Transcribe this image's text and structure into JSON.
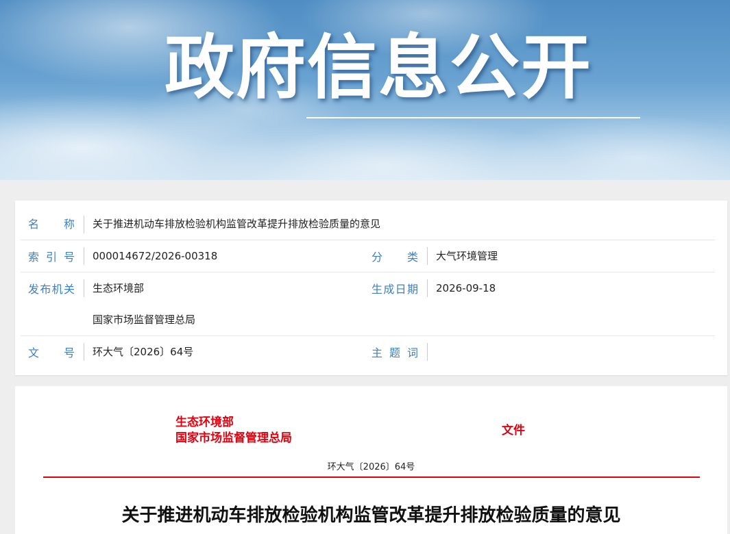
{
  "banner": {
    "title": "政府信息公开"
  },
  "info": {
    "name_label": "名称",
    "name_value": "关于推进机动车排放检验机构监管改革提升排放检验质量的意见",
    "index_label": "索引号",
    "index_value": "000014672/2026-00318",
    "category_label": "分类",
    "category_value": "大气环境管理",
    "issuer_label": "发布机关",
    "issuer_values": [
      "生态环境部",
      "国家市场监督管理总局"
    ],
    "date_label": "生成日期",
    "date_value": "2026-09-18",
    "docno_label": "文号",
    "docno_value": "环大气〔2026〕64号",
    "keywords_label": "主题词",
    "keywords_value": ""
  },
  "document": {
    "issuers": [
      "生态环境部",
      "国家市场监督管理总局"
    ],
    "file_word": "文件",
    "doc_number": "环大气〔2026〕64号",
    "title": "关于推进机动车排放检验机构监管改革提升排放检验质量的意见"
  },
  "colors": {
    "label_blue": "#3d7fc0",
    "red": "#e3000f"
  }
}
